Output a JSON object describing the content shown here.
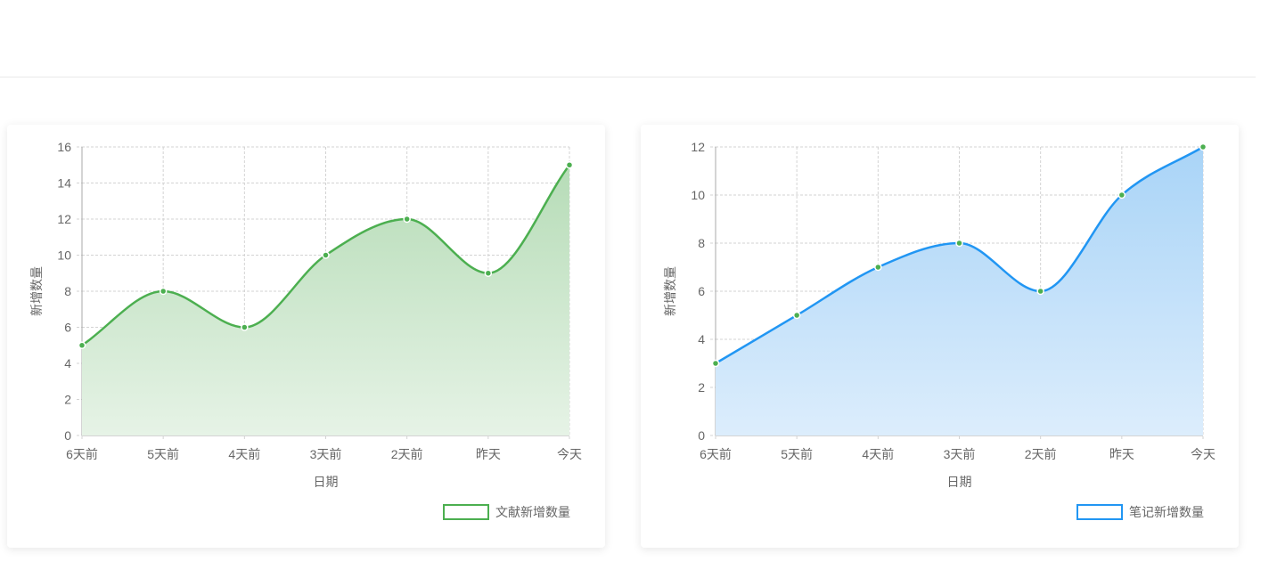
{
  "chart_data": [
    {
      "type": "area",
      "categories": [
        "6天前",
        "5天前",
        "4天前",
        "3天前",
        "2天前",
        "昨天",
        "今天"
      ],
      "series": [
        {
          "name": "文献新增数量",
          "values": [
            5,
            8,
            6,
            10,
            12,
            9,
            15
          ]
        }
      ],
      "xlabel": "日期",
      "ylabel": "新增数量",
      "ylim": [
        0,
        16
      ],
      "yticks": [
        0,
        2,
        4,
        6,
        8,
        10,
        12,
        14,
        16
      ],
      "grid": true,
      "legend": "bottom-right",
      "colors": {
        "line": "#4caf50",
        "fill_top": "#b6dcb7",
        "fill_bottom": "#e6f3e6",
        "point": "#4caf50"
      }
    },
    {
      "type": "area",
      "categories": [
        "6天前",
        "5天前",
        "4天前",
        "3天前",
        "2天前",
        "昨天",
        "今天"
      ],
      "series": [
        {
          "name": "笔记新增数量",
          "values": [
            3,
            5,
            7,
            8,
            6,
            10,
            12
          ]
        }
      ],
      "xlabel": "日期",
      "ylabel": "新增数量",
      "ylim": [
        0,
        12
      ],
      "yticks": [
        0,
        2,
        4,
        6,
        8,
        10,
        12
      ],
      "grid": true,
      "legend": "bottom-right",
      "colors": {
        "line": "#2196f3",
        "fill_top": "#a9d4f7",
        "fill_bottom": "#dcedfc",
        "point": "#4caf50"
      }
    }
  ]
}
